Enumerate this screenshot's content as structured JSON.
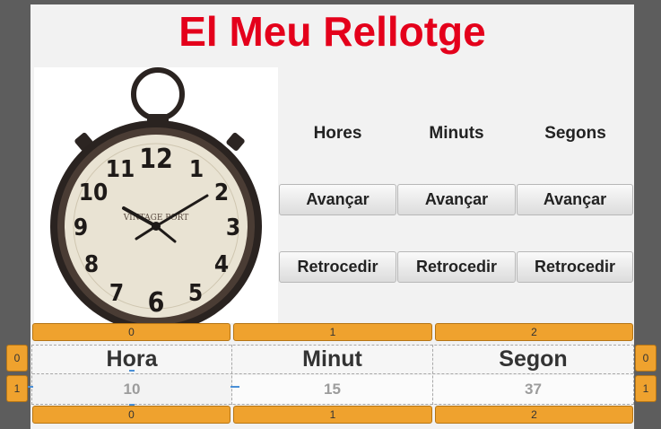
{
  "title": "El Meu Rellotge",
  "clock_image": {
    "dial_numbers": [
      "12",
      "1",
      "2",
      "3",
      "4",
      "5",
      "6",
      "7",
      "8",
      "9",
      "10",
      "11"
    ],
    "brand_text": "VINTAGE PORT"
  },
  "columns": [
    {
      "header": "Hores",
      "advance": "Avançar",
      "rewind": "Retrocedir"
    },
    {
      "header": "Minuts",
      "advance": "Avançar",
      "rewind": "Retrocedir"
    },
    {
      "header": "Segons",
      "advance": "Avançar",
      "rewind": "Retrocedir"
    }
  ],
  "grid": {
    "column_tabs": [
      "0",
      "1",
      "2"
    ],
    "row_tabs": [
      "0",
      "1"
    ],
    "headers": [
      "Hora",
      "Minut",
      "Segon"
    ],
    "values": [
      "10",
      "15",
      "37"
    ]
  },
  "colors": {
    "title": "#e4001b",
    "tab": "#efa22e"
  }
}
